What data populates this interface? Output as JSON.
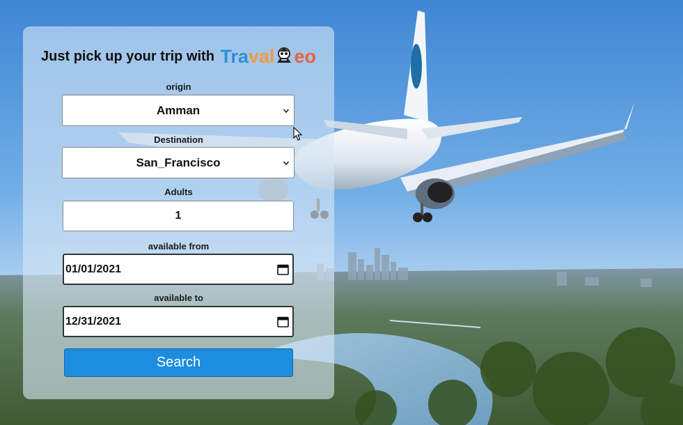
{
  "header": {
    "tagline": "Just pick up your trip with",
    "brand_part1": "Tra",
    "brand_part2": "val",
    "brand_part3": "eo"
  },
  "form": {
    "origin": {
      "label": "origin",
      "value": "Amman"
    },
    "destination": {
      "label": "Destination",
      "value": "San_Francisco"
    },
    "adults": {
      "label": "Adults",
      "value": "1"
    },
    "available_from": {
      "label": "available from",
      "value": "01/01/2021"
    },
    "available_to": {
      "label": "available to",
      "value": "12/31/2021"
    },
    "search_label": "Search"
  },
  "colors": {
    "accent": "#1d8de0",
    "brand_blue": "#2b8fd4",
    "brand_orange": "#f29a3b",
    "brand_red": "#e8623e"
  },
  "icons": {
    "select_arrow": "chevron-down-icon",
    "date_picker": "calendar-icon",
    "brand_logo": "traveler-logo-icon",
    "pointer": "mouse-cursor-icon"
  }
}
